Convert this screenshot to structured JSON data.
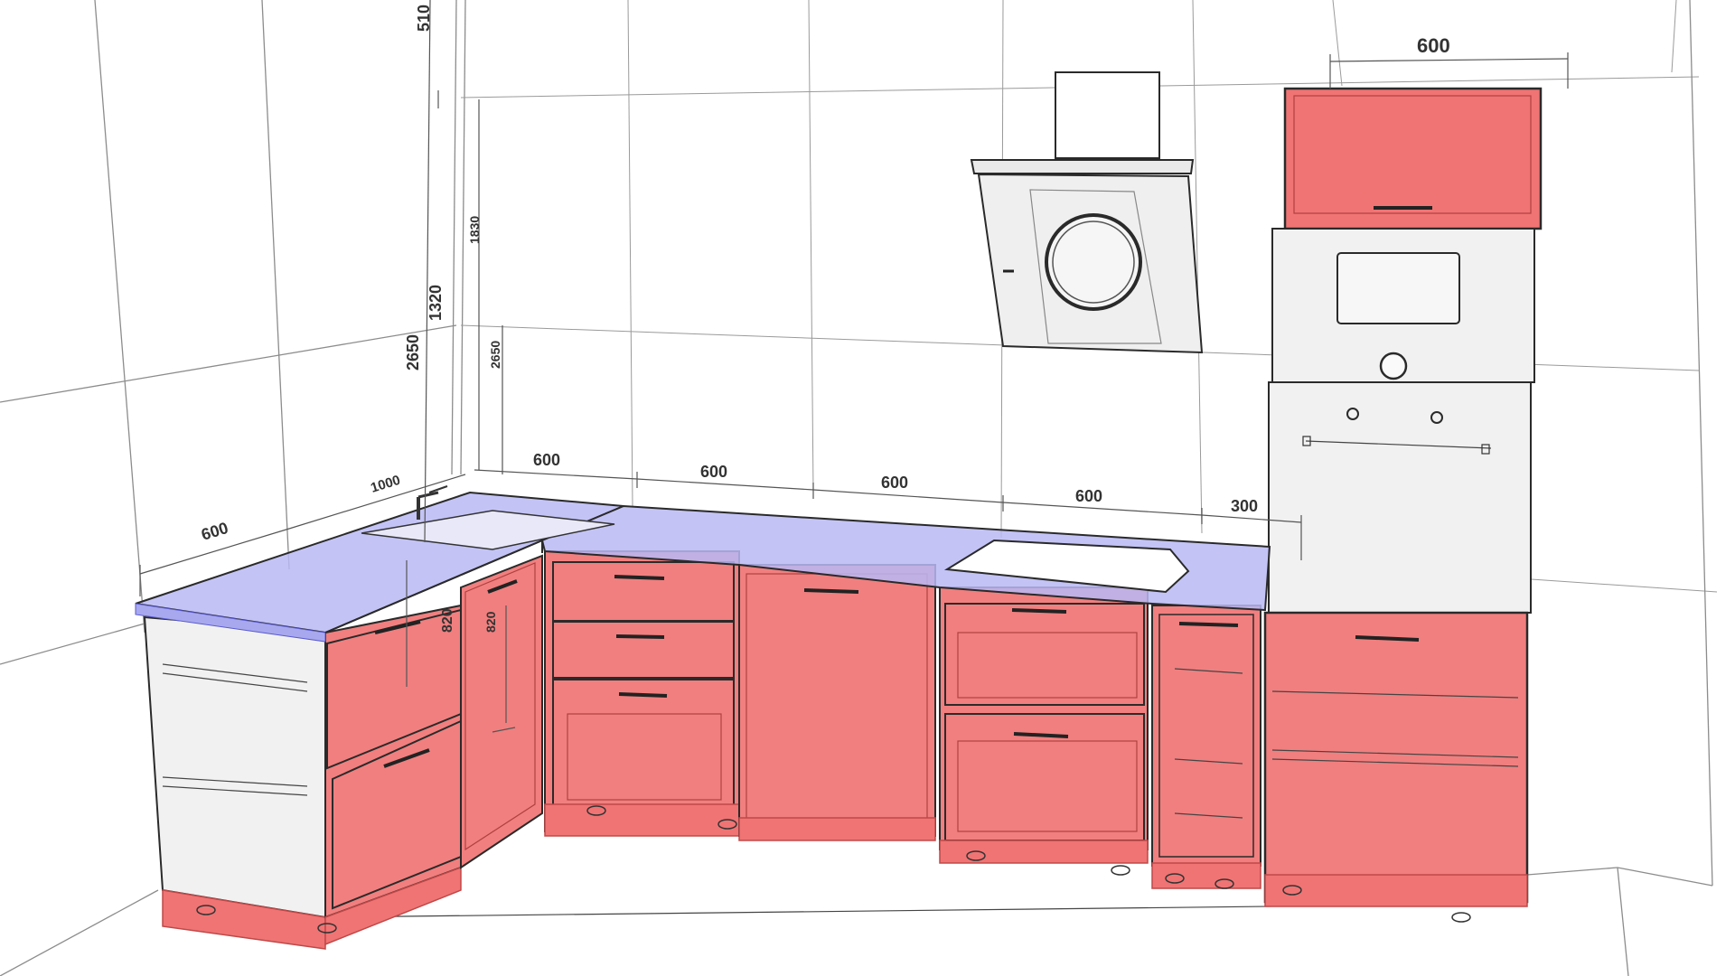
{
  "colors": {
    "cabinet_fill": "#f07474",
    "cabinet_stroke": "#c04848",
    "countertop_fill": "#b8b8f4",
    "countertop_stroke": "#5a5ad0",
    "appliance_fill": "#f1f1f1",
    "edge_dark": "#2a2a2a"
  },
  "dimensions": {
    "left_side_depth": "600",
    "corner_length": "1000",
    "back_1": "600",
    "back_2": "600",
    "back_3": "600",
    "back_4": "600",
    "back_5": "300",
    "tall_cabinet_width": "600",
    "height_total_a": "2650",
    "height_total_b": "2650",
    "height_1320": "1320",
    "height_1830": "1830",
    "height_510": "510",
    "base_height_a": "820",
    "base_height_b": "820"
  },
  "icons": {
    "hood": "range-hood-icon",
    "hob": "induction-hob-icon",
    "oven": "built-in-oven-icon",
    "microwave": "built-in-microwave-icon",
    "sink": "sink-icon",
    "faucet": "faucet-icon"
  }
}
